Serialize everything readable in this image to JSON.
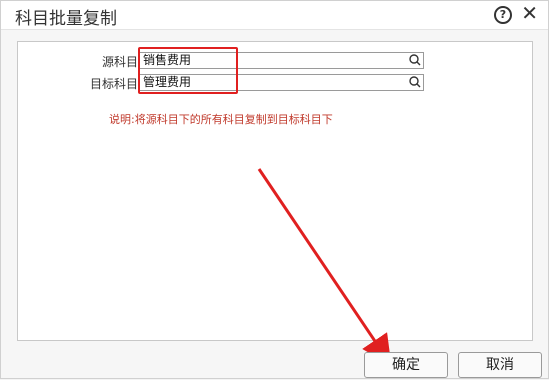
{
  "dialog": {
    "title": "科目批量复制",
    "help_glyph": "?",
    "close_glyph": "✕"
  },
  "form": {
    "source_label": "源科目",
    "source_value": "销售费用",
    "target_label": "目标科目",
    "target_value": "管理费用",
    "note": "说明:将源科目下的所有科目复制到目标科目下"
  },
  "buttons": {
    "ok": "确定",
    "cancel": "取消"
  },
  "annotation_color": "#e02020"
}
